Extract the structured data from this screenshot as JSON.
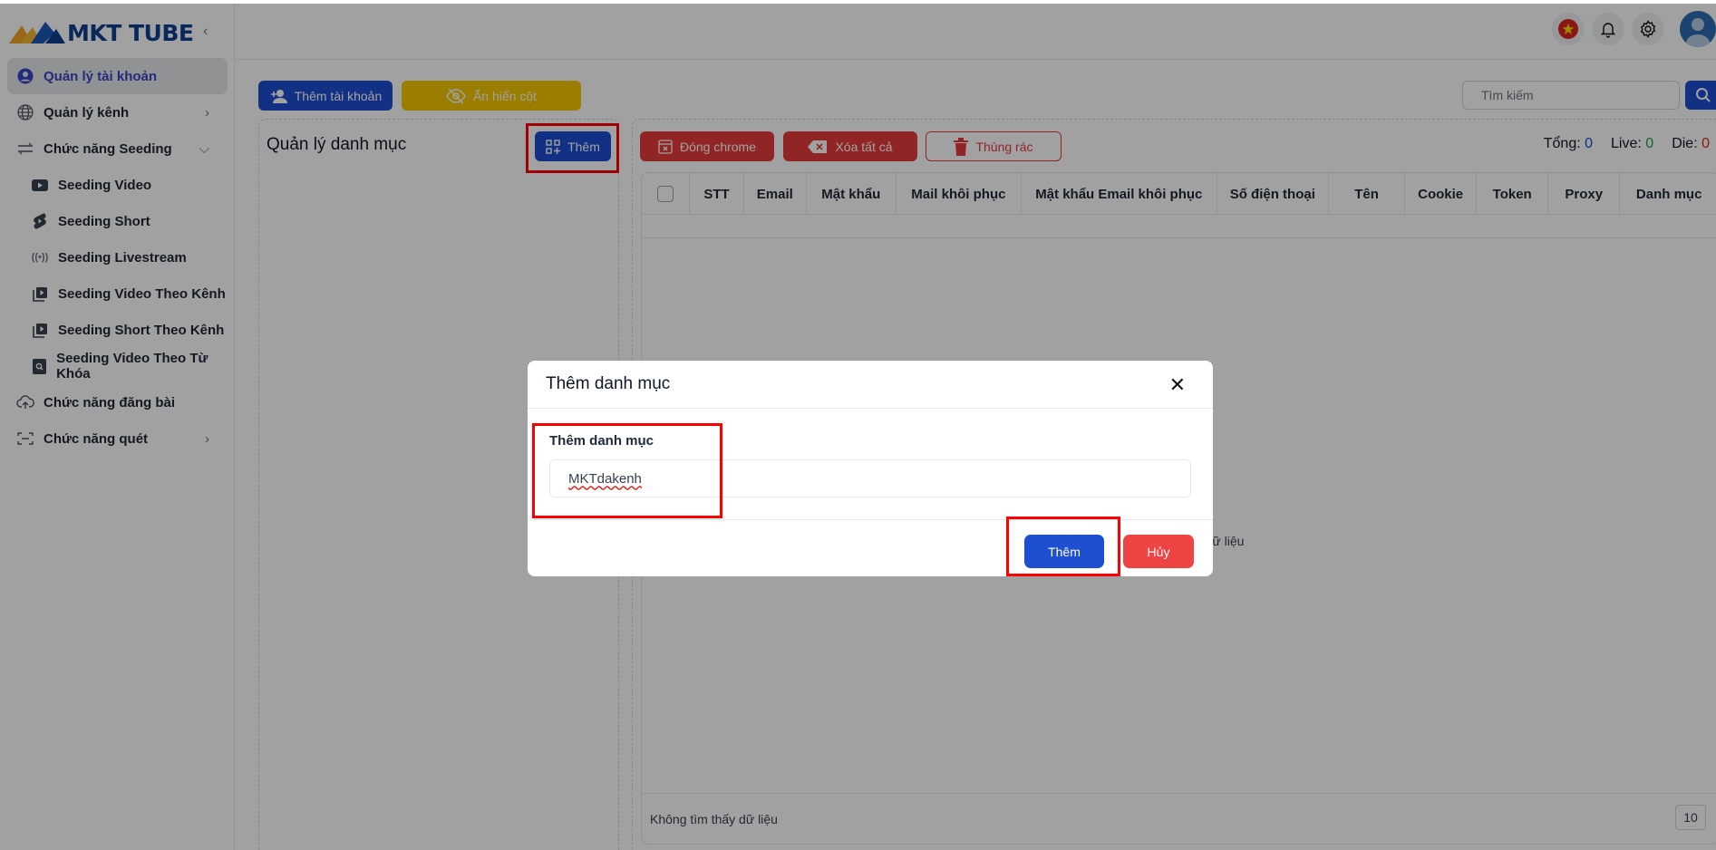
{
  "app": {
    "logo_text": "MKT TUBE",
    "collapse_icon": "chevron-left-icon"
  },
  "sidebar": {
    "items": [
      {
        "label": "Quản lý tài khoản",
        "icon": "user-circle-icon",
        "active": true
      },
      {
        "label": "Quản lý kênh",
        "icon": "globe-icon",
        "chevron": "›"
      },
      {
        "label": "Chức năng Seeding",
        "icon": "swap-icon",
        "chevron": "⌄"
      },
      {
        "label": "Seeding Video",
        "icon": "youtube-icon"
      },
      {
        "label": "Seeding Short",
        "icon": "shorts-icon"
      },
      {
        "label": "Seeding Livestream",
        "icon": "broadcast-icon"
      },
      {
        "label": "Seeding Video Theo Kênh",
        "icon": "video-library-icon"
      },
      {
        "label": "Seeding Short Theo Kênh",
        "icon": "video-library-icon"
      },
      {
        "label": "Seeding Video Theo Từ Khóa",
        "icon": "search-doc-icon"
      },
      {
        "label": "Chức năng đăng bài",
        "icon": "cloud-upload-icon"
      },
      {
        "label": "Chức năng quét",
        "icon": "scan-icon",
        "chevron": "›"
      }
    ]
  },
  "header": {
    "flag": "vietnam-flag-icon",
    "bell": "bell-icon",
    "settings": "gear-icon",
    "avatar": "avatar-icon"
  },
  "toolbar": {
    "add_account": "Thêm tài khoản",
    "toggle_columns": "Ẩn hiển cột",
    "search_placeholder": "Tìm kiếm"
  },
  "category_panel": {
    "title": "Quản lý danh mục",
    "add_button": "Thêm"
  },
  "actions": {
    "close_chrome": "Đóng chrome",
    "delete_all": "Xóa tất cả",
    "trash": "Thùng rác"
  },
  "stats": {
    "total_label": "Tổng:",
    "total": "0",
    "live_label": "Live:",
    "live": "0",
    "die_label": "Die:",
    "die": "0"
  },
  "colors": {
    "total": "#1f4fd1",
    "live": "#22a04b",
    "die": "#e02424"
  },
  "table": {
    "columns": [
      "STT",
      "Email",
      "Mật khẩu",
      "Mail khôi phục",
      "Mật khẩu Email khôi phục",
      "Số điện thoại",
      "Tên",
      "Cookie",
      "Token",
      "Proxy",
      "Danh mục"
    ],
    "empty_text": "Không tìm thấy dữ liệu",
    "footer_text": "Không tìm thấy dữ liệu",
    "page_size": "10"
  },
  "modal": {
    "title": "Thêm danh mục",
    "field_label": "Thêm danh mục",
    "field_value": "MKTdakenh",
    "confirm": "Thêm",
    "cancel": "Hủy"
  }
}
